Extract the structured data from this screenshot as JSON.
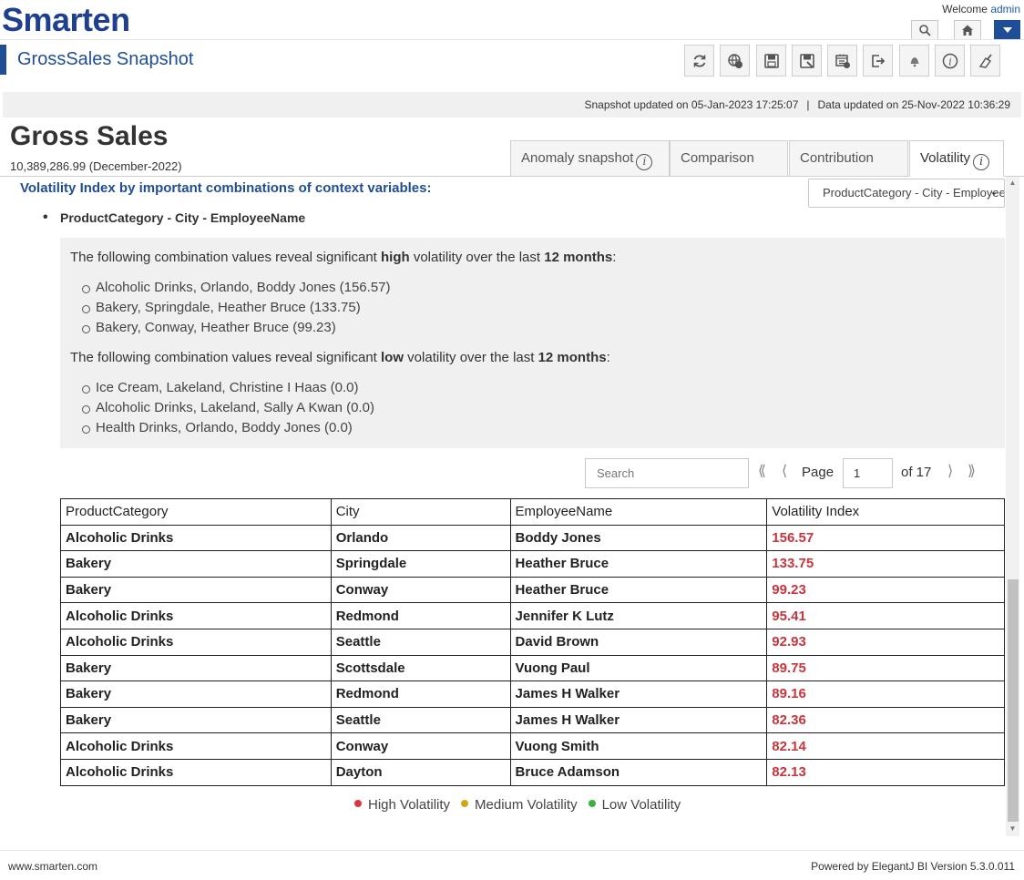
{
  "header": {
    "logo": "Smarten",
    "welcome": "Welcome",
    "user": "admin",
    "title": "GrossSales Snapshot"
  },
  "infobar": {
    "snapshot": "Snapshot updated on 05-Jan-2023 17:25:07",
    "separator": "|",
    "data": "Data updated on 25-Nov-2022 10:36:29"
  },
  "kpi": {
    "title": "Gross Sales",
    "value": "10,389,286.99 (December-2022)"
  },
  "tabs": [
    {
      "label": "Anomaly snapshot",
      "has_info": true
    },
    {
      "label": "Comparison",
      "has_info": false
    },
    {
      "label": "Contribution",
      "has_info": false
    },
    {
      "label": "Volatility",
      "has_info": true,
      "active": true
    }
  ],
  "volatility": {
    "heading": "Volatility Index by important combinations of context variables:",
    "selector_value": "ProductCategory - City - EmployeeName",
    "combination": "ProductCategory - City - EmployeeName",
    "high": {
      "prefix": "The following combination values reveal significant ",
      "level": "high",
      "middle": " volatility over the last ",
      "period": "12 months",
      "suffix": ":",
      "items": [
        "Alcoholic Drinks, Orlando, Boddy Jones (156.57)",
        "Bakery, Springdale, Heather Bruce (133.75)",
        "Bakery, Conway, Heather Bruce (99.23)"
      ]
    },
    "low": {
      "prefix": "The following combination values reveal significant ",
      "level": "low",
      "middle": " volatility over the last ",
      "period": "12 months",
      "suffix": ":",
      "items": [
        "Ice Cream, Lakeland, Christine I Haas (0.0)",
        "Alcoholic Drinks, Lakeland, Sally A Kwan (0.0)",
        "Health Drinks, Orlando, Boddy Jones (0.0)"
      ]
    }
  },
  "pager": {
    "search_placeholder": "Search",
    "page_label": "Page",
    "page_value": "1",
    "of_label": "of 17"
  },
  "table": {
    "columns": [
      "ProductCategory",
      "City",
      "EmployeeName",
      "Volatility Index"
    ],
    "rows": [
      [
        "Alcoholic Drinks",
        "Orlando",
        "Boddy Jones",
        "156.57"
      ],
      [
        "Bakery",
        "Springdale",
        "Heather Bruce",
        "133.75"
      ],
      [
        "Bakery",
        "Conway",
        "Heather Bruce",
        "99.23"
      ],
      [
        "Alcoholic Drinks",
        "Redmond",
        "Jennifer K Lutz",
        "95.41"
      ],
      [
        "Alcoholic Drinks",
        "Seattle",
        "David Brown",
        "92.93"
      ],
      [
        "Bakery",
        "Scottsdale",
        "Vuong Paul",
        "89.75"
      ],
      [
        "Bakery",
        "Redmond",
        "James H Walker",
        "89.16"
      ],
      [
        "Bakery",
        "Seattle",
        "James H Walker",
        "82.36"
      ],
      [
        "Alcoholic Drinks",
        "Conway",
        "Vuong Smith",
        "82.14"
      ],
      [
        "Alcoholic Drinks",
        "Dayton",
        "Bruce Adamson",
        "82.13"
      ]
    ]
  },
  "legend": [
    {
      "label": "High Volatility",
      "color": "#d9363e"
    },
    {
      "label": "Medium Volatility",
      "color": "#d4a514"
    },
    {
      "label": "Low Volatility",
      "color": "#3cb043"
    }
  ],
  "footer": {
    "left": "www.smarten.com",
    "right": "Powered by ElegantJ BI Version 5.3.0.011"
  },
  "icons": {
    "top": [
      "search-icon",
      "home-icon",
      "caret-down-icon"
    ],
    "toolbar": [
      "refresh-icon",
      "globe-icon",
      "save-icon",
      "save-as-icon",
      "schedule-icon",
      "exit-icon",
      "bell-icon",
      "info-icon",
      "cleanup-icon"
    ]
  }
}
